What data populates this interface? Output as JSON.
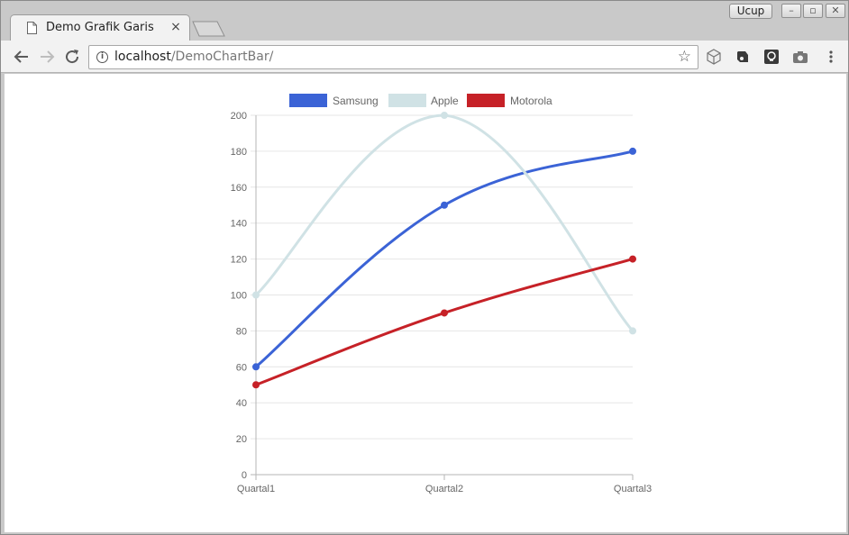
{
  "browser": {
    "tab_title": "Demo Grafik Garis",
    "tab_close": "×",
    "profile_name": "Ucup",
    "url_host": "localhost",
    "url_path": "/DemoChartBar/"
  },
  "icons": {
    "page": "page-icon",
    "back": "back-arrow-icon",
    "forward": "forward-arrow-icon",
    "reload": "reload-icon",
    "info": "info-icon",
    "star": "star-icon",
    "menu": "more-vert-icon"
  },
  "chart_data": {
    "type": "line",
    "categories": [
      "Quartal1",
      "Quartal2",
      "Quartal3"
    ],
    "series": [
      {
        "name": "Samsung",
        "values": [
          60,
          150,
          180
        ],
        "color": "#3b63d6"
      },
      {
        "name": "Apple",
        "values": [
          100,
          200,
          80
        ],
        "color": "#d0e2e5"
      },
      {
        "name": "Motorola",
        "values": [
          50,
          90,
          120
        ],
        "color": "#c62127"
      }
    ],
    "ylim": [
      0,
      200
    ],
    "yticks": [
      "0",
      "20",
      "40",
      "60",
      "80",
      "100",
      "120",
      "140",
      "160",
      "180",
      "200"
    ],
    "grid": true,
    "legend": "top"
  }
}
